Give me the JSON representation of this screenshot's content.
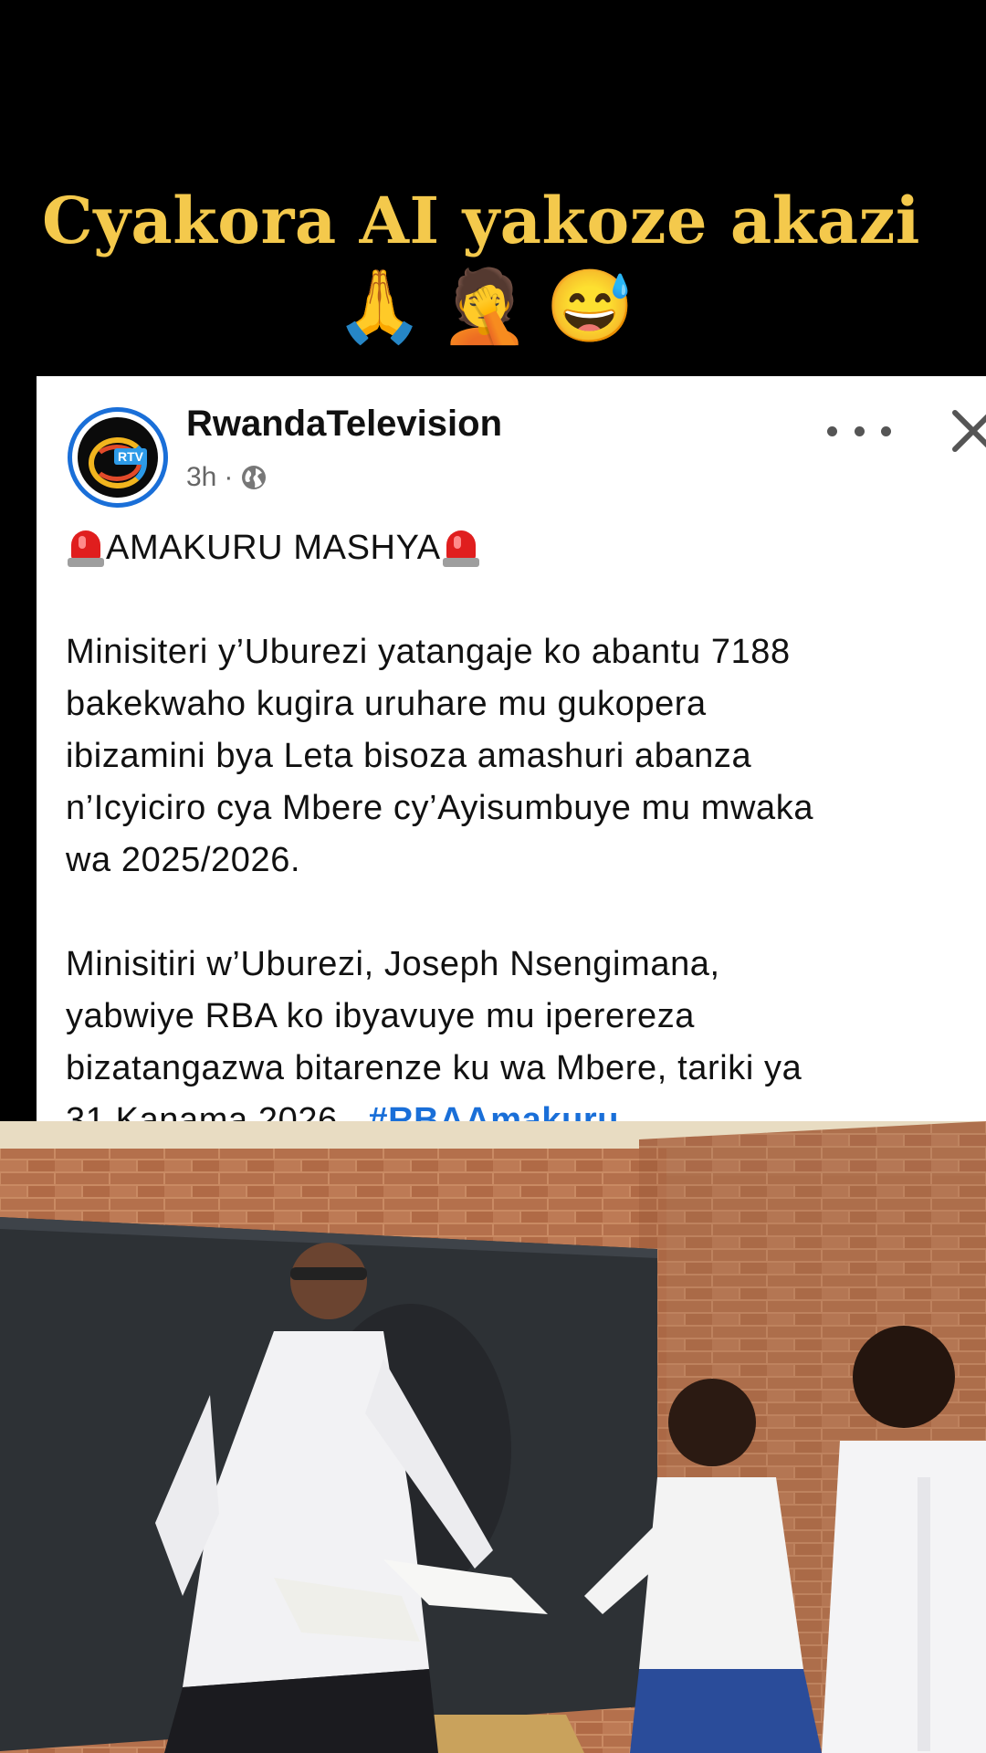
{
  "caption": {
    "title": "Cyakora AI yakoze akazi",
    "emojis": "🙏🤦😅"
  },
  "post": {
    "page_name": "RwandaTelevision",
    "avatar_text": "RTV",
    "time": "3h",
    "dot": "·",
    "headline": "AMAKURU MASHYA",
    "paragraph1_lines": [
      "Minisiteri y’Uburezi yatangaje ko abantu 7188",
      "bakekwaho kugira uruhare mu gukopera",
      "ibizamini bya Leta bisoza amashuri abanza",
      "n’Icyiciro cya Mbere cy’Ayisumbuye mu mwaka",
      "wa 2025/2026."
    ],
    "paragraph2_lines": [
      "Minisitiri w’Uburezi, Joseph Nsengimana,",
      "yabwiye RBA ko ibyavuye mu iperereza",
      "bizatangazwa bitarenze ku wa Mbere, tariki ya"
    ],
    "last_line_text": "31 Kanama 2026.",
    "hashtag": "#RBAAmakuru"
  },
  "colors": {
    "caption": "#f4c94c",
    "link": "#1a6fd8",
    "background": "#000000"
  },
  "icons": [
    "rtv-logo-icon",
    "globe-icon",
    "more-options-icon",
    "close-icon",
    "siren-icon"
  ]
}
